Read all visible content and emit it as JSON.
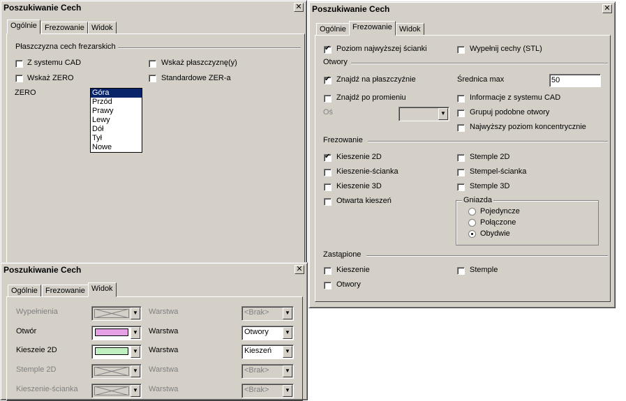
{
  "colors": {
    "face": "#d4d0c8",
    "selection": "#0a246a",
    "pink": "#e6a0e6",
    "green": "#c0f0c0"
  },
  "dialog_general": {
    "title": "Poszukiwanie Cech",
    "close_glyph": "✕",
    "tabs": [
      "Ogólnie",
      "Frezowanie",
      "Widok"
    ],
    "active_tab": "Ogólnie",
    "group_label": "Płaszczyzna cech frezarskich",
    "checkboxes": [
      {
        "label": "Z systemu CAD",
        "checked": false
      },
      {
        "label": "Wskaż płaszczyznę(y)",
        "checked": false
      },
      {
        "label": "Wskaż ZERO",
        "checked": false
      },
      {
        "label": "Standardowe ZER-a",
        "checked": false
      }
    ],
    "zero_label": "ZERO",
    "zero_options": [
      "Góra",
      "Przód",
      "Prawy",
      "Lewy",
      "Dół",
      "Tył",
      "Nowe"
    ],
    "zero_selected": "Góra"
  },
  "dialog_milling": {
    "title": "Poszukiwanie Cech",
    "close_glyph": "✕",
    "tabs": [
      "Ogólnie",
      "Frezowanie",
      "Widok"
    ],
    "active_tab": "Frezowanie",
    "top_checks": [
      {
        "label": "Poziom najwyższej ścianki",
        "checked": true
      },
      {
        "label": "Wypełnij cechy (STL)",
        "checked": false
      }
    ],
    "holes": {
      "label": "Otwory",
      "find_on_plane": {
        "label": "Znajdź na płaszczyźnie",
        "checked": true
      },
      "max_diameter_label": "Średnica max",
      "max_diameter_value": "50",
      "find_by_radius": {
        "label": "Znajdź po promieniu",
        "checked": false
      },
      "cad_info": {
        "label": "Informacje z systemu CAD",
        "checked": false
      },
      "axis_label": "Oś",
      "group_similar": {
        "label": "Grupuj podobne otwory",
        "checked": false
      },
      "top_concentric": {
        "label": "Najwyższy poziom koncentrycznie",
        "checked": false
      }
    },
    "milling": {
      "label": "Frezowanie",
      "items": [
        {
          "label": "Kieszenie 2D",
          "checked": true
        },
        {
          "label": "Stemple 2D",
          "checked": false
        },
        {
          "label": "Kieszenie-ścianka",
          "checked": false
        },
        {
          "label": "Stempel-ścianka",
          "checked": false
        },
        {
          "label": "Kieszenie 3D",
          "checked": false
        },
        {
          "label": "Stemple 3D",
          "checked": false
        },
        {
          "label": "Otwarta kieszeń",
          "checked": false
        }
      ],
      "sockets": {
        "label": "Gniazda",
        "options": [
          "Pojedyncze",
          "Połączone",
          "Obydwie"
        ],
        "selected": "Obydwie"
      }
    },
    "replaced": {
      "label": "Zastąpione",
      "items": [
        {
          "label": "Kieszenie",
          "checked": false
        },
        {
          "label": "Stemple",
          "checked": false
        },
        {
          "label": "Otwory",
          "checked": false
        }
      ]
    }
  },
  "dialog_view": {
    "title": "Poszukiwanie Cech",
    "close_glyph": "✕",
    "tabs": [
      "Ogólnie",
      "Frezowanie",
      "Widok"
    ],
    "active_tab": "Widok",
    "layer_label": "Warstwa",
    "rows": [
      {
        "label": "Wypełnienia",
        "enabled": false,
        "layer": "<Brak>"
      },
      {
        "label": "Otwór",
        "enabled": true,
        "color": "#e6a0e6",
        "layer": "Otwory"
      },
      {
        "label": "Kieszeie 2D",
        "enabled": true,
        "color": "#c0f0c0",
        "layer": "Kieszeń"
      },
      {
        "label": "Stemple 2D",
        "enabled": false,
        "layer": "<Brak>"
      },
      {
        "label": "Kieszenie-ścianka",
        "enabled": false,
        "layer": "<Brak>"
      }
    ]
  }
}
